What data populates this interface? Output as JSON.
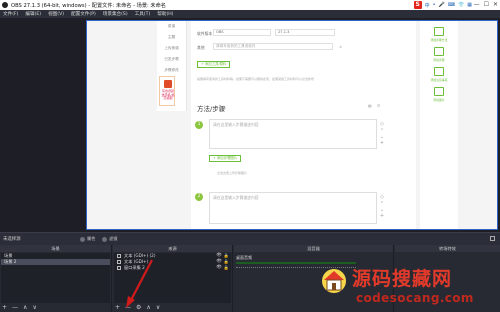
{
  "window": {
    "title": "OBS 27.1.3 (64-bit, windows) - 配置文件: 未命名 - 场景: 未命名",
    "controls": [
      "—",
      "☐",
      "✕"
    ],
    "ime_label": "S",
    "ime_icons": [
      "中",
      "•",
      "🎤",
      "⌨",
      "👕",
      "▦"
    ]
  },
  "menu": [
    "文件(F)",
    "编辑(E)",
    "视图(V)",
    "配置文件(P)",
    "场景集合(S)",
    "工具(T)",
    "帮助(H)"
  ],
  "webpage": {
    "left_nav": [
      "菜谱",
      "主题",
      "上传食谱",
      "已发步骤",
      "步骤修改"
    ],
    "promo_text": "写食谱就送手机/最高奖励",
    "fields": {
      "software_label": "软件版本",
      "software_value": "OBS",
      "version_value": "27.1.3",
      "other_label": "其他",
      "other_placeholder": "请填写用到的工具或软件"
    },
    "add_tool_button": "+ 添加工具/原料",
    "tool_hint": "提醒填写使用的工具材料等，如果不需要可以删除此项，如果其他工具材料可以点击新增",
    "section_title": "方法/步骤",
    "step1_number": "1",
    "step2_number": "2",
    "step_placeholder": "请在这里输入步骤描述内容",
    "add_image_button": "+ 添加步骤图片",
    "upload_hint": "点击这里上传步骤图片",
    "side_ops": [
      "◇",
      "⌃",
      "⌄",
      "+"
    ],
    "right_panel": [
      "添加步骤方法",
      "添加步骤",
      "添加注意事项",
      "添加图片"
    ]
  },
  "scene_toolbar": {
    "no_source": "未选择源",
    "properties": "属性",
    "filters": "滤镜"
  },
  "docks": {
    "scenes": {
      "header": "场景",
      "items": [
        "场景",
        "场景 2"
      ],
      "selected_index": 1,
      "footer": [
        "+",
        "—",
        "∧",
        "∨"
      ]
    },
    "sources": {
      "header": "来源",
      "items": [
        "文本 (GDI+) (2)",
        "文本 (GDI+)",
        "窗口采集 2"
      ],
      "footer": [
        "+",
        "—",
        "⚙",
        "∧",
        "∨"
      ],
      "visible_icon": "👁",
      "lock_icon": "🔒"
    },
    "mixer": {
      "header": "混音器",
      "channel": "桌面音频",
      "ticks": "-60 -55 -50 -45 -40 -35 -30 -25 -20 -15 -10 -5 0"
    },
    "transitions": {
      "header": "转场特效"
    }
  },
  "watermark": {
    "title": "源码搜藏网",
    "url": "codesocang.com"
  },
  "colors": {
    "accent_green": "#8cc63f",
    "preview_border": "#2e63c7",
    "watermark_red": "#e23a2a",
    "arrow_red": "#d11a1a"
  }
}
